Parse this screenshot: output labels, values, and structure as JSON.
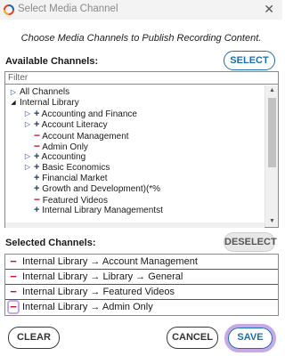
{
  "window": {
    "title": "Select Media Channel",
    "close_label": "✕"
  },
  "instruction": "Choose Media Channels to Publish Recording Content.",
  "available": {
    "label": "Available Channels:",
    "select_button": "SELECT",
    "filter_placeholder": "Filter",
    "tree": [
      {
        "glyph": "▷",
        "glyph_kind": "expand",
        "text": "All Channels",
        "indent": 0
      },
      {
        "glyph": "◢",
        "glyph_kind": "collapse",
        "text": "Internal  Library",
        "indent": 0
      },
      {
        "glyph": "▷",
        "glyph_kind": "expand",
        "text": "",
        "indent": 1
      },
      {
        "glyph": "▷",
        "glyph_kind": "expand",
        "text": "",
        "indent": 1
      },
      {
        "glyph": "",
        "glyph_kind": "none",
        "text": "",
        "indent": 1
      },
      {
        "glyph": "",
        "glyph_kind": "none",
        "text": "",
        "indent": 1
      },
      {
        "glyph": "▷",
        "glyph_kind": "expand",
        "text": "",
        "indent": 1
      },
      {
        "glyph": "▷",
        "glyph_kind": "expand",
        "text": "",
        "indent": 1
      },
      {
        "glyph": "",
        "glyph_kind": "none",
        "text": "",
        "indent": 1
      },
      {
        "glyph": "",
        "glyph_kind": "none",
        "text": "",
        "indent": 1
      },
      {
        "glyph": "",
        "glyph_kind": "none",
        "text": "",
        "indent": 1
      },
      {
        "glyph": "",
        "glyph_kind": "none",
        "text": "",
        "indent": 1
      },
      {
        "glyph": "▷",
        "glyph_kind": "expand",
        "text": "",
        "indent": 1
      }
    ],
    "channels": [
      {
        "sign": "+",
        "kind": "plus",
        "text": "Accounting and Finance"
      },
      {
        "sign": "+",
        "kind": "plus",
        "text": "Account Literacy"
      },
      {
        "sign": "−",
        "kind": "minus",
        "text": "Account Management"
      },
      {
        "sign": "−",
        "kind": "minus",
        "text": "Admin Only"
      },
      {
        "sign": "+",
        "kind": "plus",
        "text": "Accounting"
      },
      {
        "sign": "+",
        "kind": "plus",
        "text": "Basic Economics"
      },
      {
        "sign": "+",
        "kind": "plus",
        "text": "Financial Market"
      },
      {
        "sign": "+",
        "kind": "plus",
        "text": "Growth and Development)(*%"
      },
      {
        "sign": "−",
        "kind": "minus",
        "text": "Featured Videos"
      },
      {
        "sign": "+",
        "kind": "plus",
        "text": "Internal Library Managementst"
      },
      {
        "sign": "+",
        "kind": "plus",
        "text": "..."
      }
    ]
  },
  "selected": {
    "label": "Selected Channels:",
    "deselect_button": "DESELECT",
    "items": [
      {
        "sign": "−",
        "text": "Internal  Library → Account Management"
      },
      {
        "sign": "−",
        "text": "Internal  Library → Library → General"
      },
      {
        "sign": "−",
        "text": "Internal  Library → Featured Videos"
      },
      {
        "sign": "−",
        "text": "Internal  Library → Admin Only",
        "highlighted": true
      }
    ]
  },
  "buttons": {
    "clear": "CLEAR",
    "cancel": "CANCEL",
    "save": "SAVE"
  },
  "colors": {
    "accent": "#1a6fb0",
    "remove": "#c8102e",
    "add": "#1a3d7c",
    "focus_ring": "#c8a8e6"
  }
}
